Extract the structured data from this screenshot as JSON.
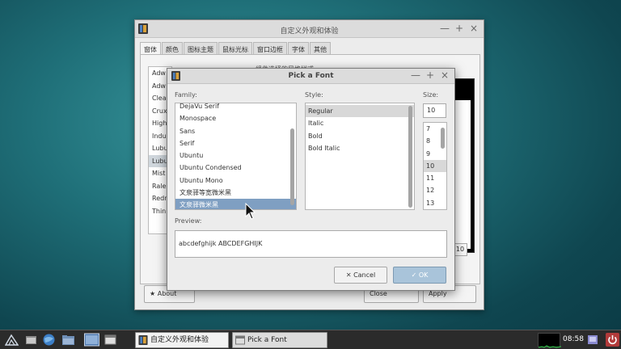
{
  "back_window": {
    "title": "自定义外观和体验",
    "controls": [
      "—",
      "+",
      "×"
    ],
    "tabs": [
      "窗体",
      "颜色",
      "图标主题",
      "鼠标光标",
      "窗口边框",
      "字体",
      "其他"
    ],
    "theme_items": [
      "Adw",
      "Adw",
      "Clea",
      "Crux",
      "High",
      "Indu",
      "Lubu",
      "Lubu",
      "Mist",
      "Rale",
      "Redr",
      "Thin"
    ],
    "theme_selected_index": 7,
    "label": "组件选择的风格样式",
    "size_value": "10",
    "about_label": "About",
    "close_label": "Close",
    "apply_label": "Apply"
  },
  "dialog": {
    "title": "Pick a Font",
    "controls": [
      "—",
      "+",
      "×"
    ],
    "family_label": "Family:",
    "style_label": "Style:",
    "size_label": "Size:",
    "families": [
      "DejaVu Serif",
      "Monospace",
      "Sans",
      "Serif",
      "Ubuntu",
      "Ubuntu Condensed",
      "Ubuntu Mono",
      "文泉驿等宽微米黑",
      "文泉驿微米黑"
    ],
    "family_selected_index": 8,
    "styles": [
      "Regular",
      "Italic",
      "Bold",
      "Bold Italic"
    ],
    "style_selected_index": 0,
    "size_value": "10",
    "sizes": [
      "7",
      "8",
      "9",
      "10",
      "11",
      "12",
      "13"
    ],
    "size_selected_index": 3,
    "preview_label": "Preview:",
    "preview_text": "abcdefghijk ABCDEFGHIJK",
    "cancel_label": "Cancel",
    "ok_label": "OK"
  },
  "taskbar": {
    "tasks": [
      "自定义外观和体验",
      "Pick a Font"
    ],
    "clock": "08:58"
  },
  "colors": {
    "selection_blue": "#7f9fc2",
    "ok_button": "#a9c4da",
    "taskbar": "#2b2b2b"
  },
  "icons": [
    "lubuntu-logo-icon",
    "file-manager-icon",
    "browser-icon",
    "folder-icon",
    "show-desktop-icon",
    "window-icon",
    "app-icon",
    "cancel-icon",
    "check-icon",
    "star-icon",
    "volume-icon",
    "power-icon"
  ]
}
